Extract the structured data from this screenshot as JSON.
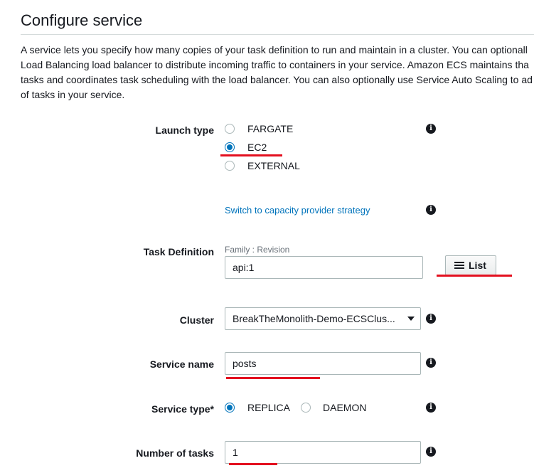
{
  "section": {
    "title": "Configure service",
    "description_lines": [
      "A service lets you specify how many copies of your task definition to run and maintain in a cluster. You can optionall",
      "Load Balancing load balancer to distribute incoming traffic to containers in your service. Amazon ECS maintains tha",
      "tasks and coordinates task scheduling with the load balancer. You can also optionally use Service Auto Scaling to ad",
      "of tasks in your service."
    ]
  },
  "launch_type": {
    "label": "Launch type",
    "options": [
      "FARGATE",
      "EC2",
      "EXTERNAL"
    ],
    "selected": "EC2",
    "capacity_link": "Switch to capacity provider strategy"
  },
  "task_definition": {
    "label": "Task Definition",
    "hint": "Family : Revision",
    "value": "api:1",
    "list_button": "List"
  },
  "cluster": {
    "label": "Cluster",
    "value": "BreakTheMonolith-Demo-ECSClus..."
  },
  "service_name": {
    "label": "Service name",
    "value": "posts"
  },
  "service_type": {
    "label": "Service type*",
    "options": [
      "REPLICA",
      "DAEMON"
    ],
    "selected": "REPLICA"
  },
  "number_of_tasks": {
    "label": "Number of tasks",
    "value": "1"
  },
  "icons": {
    "info": "info-icon",
    "list": "list-icon",
    "dropdown": "chevron-down-icon"
  },
  "colors": {
    "accent": "#0073bb",
    "annotation": "#e3101f"
  }
}
